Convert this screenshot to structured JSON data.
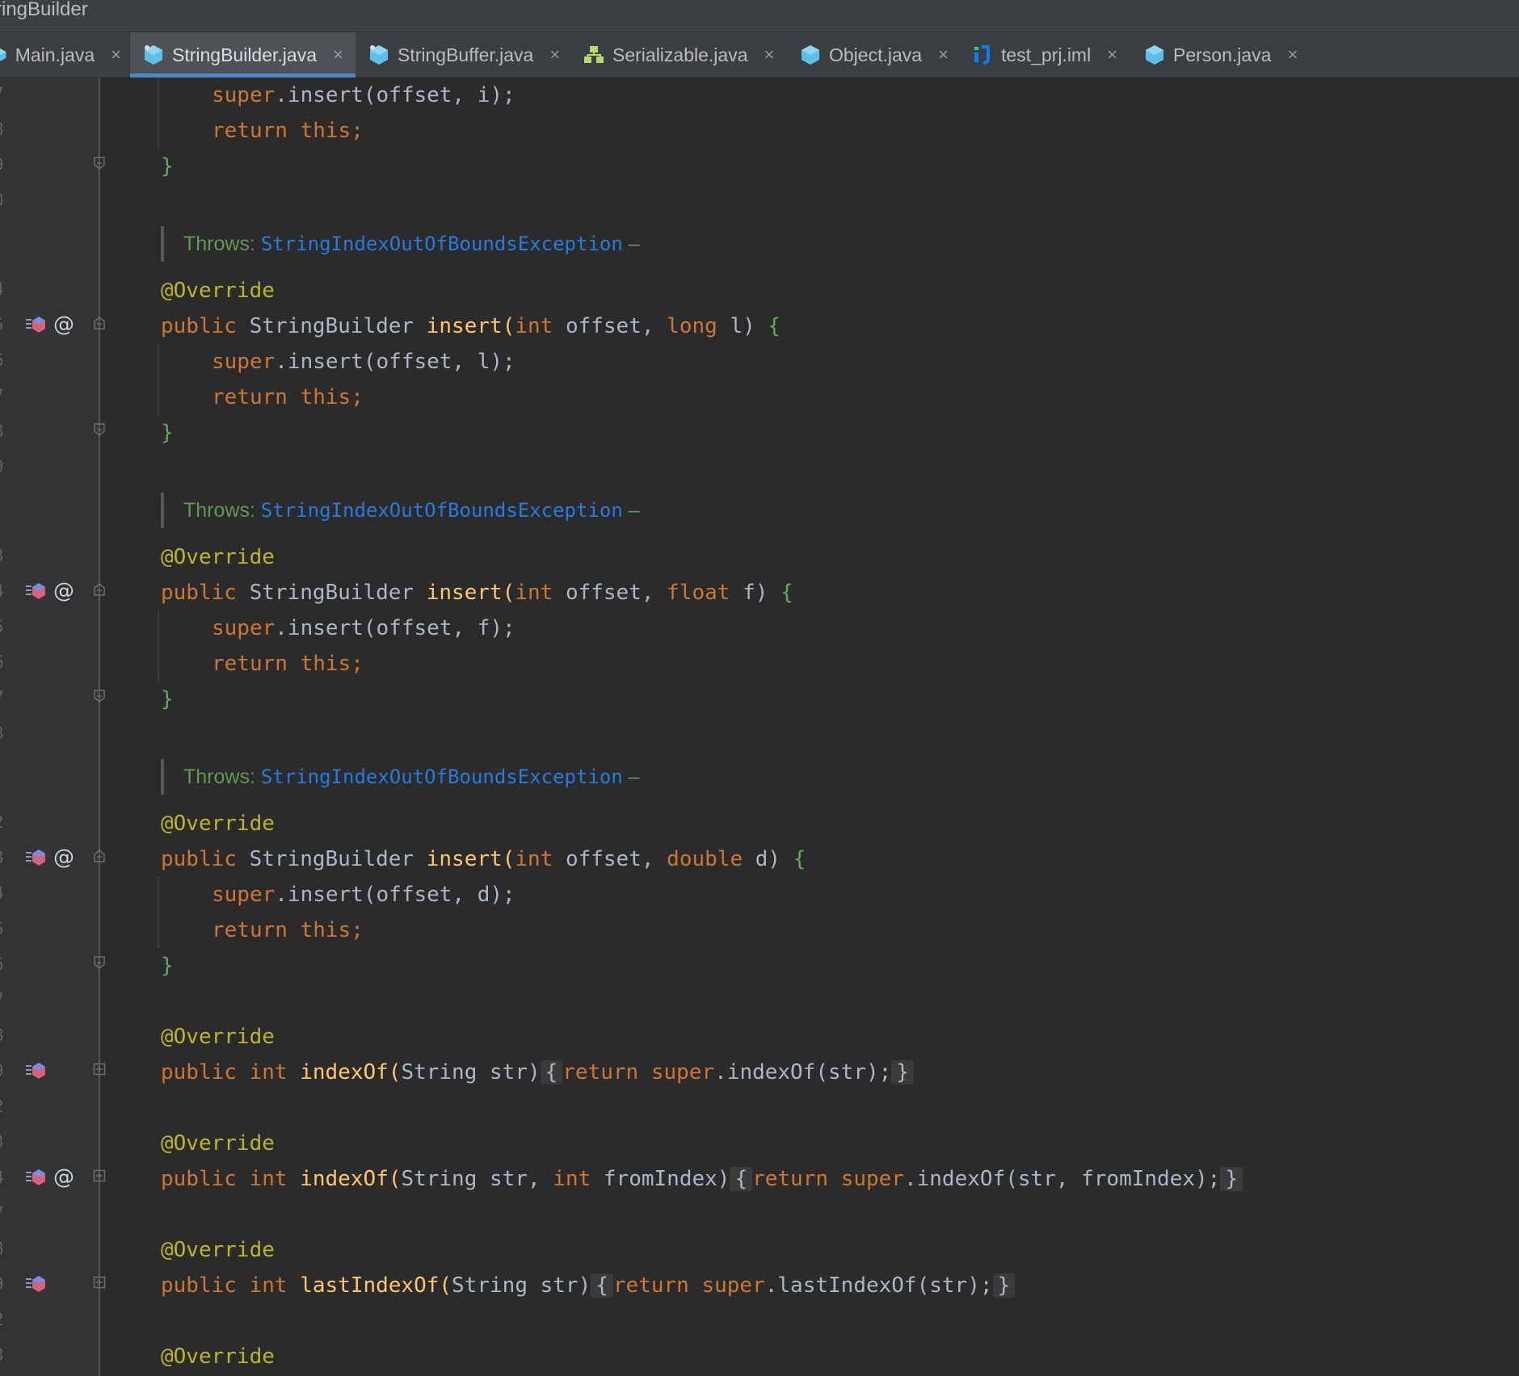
{
  "window": {
    "title": "ringBuilder"
  },
  "tabs": [
    {
      "label": "Main.java",
      "icon": "java-class-icon",
      "active": false
    },
    {
      "label": "StringBuilder.java",
      "icon": "java-class-icon",
      "active": true
    },
    {
      "label": "StringBuffer.java",
      "icon": "java-class-icon",
      "active": false
    },
    {
      "label": "Serializable.java",
      "icon": "interface-icon",
      "active": false
    },
    {
      "label": "Object.java",
      "icon": "java-class-icon",
      "active": false
    },
    {
      "label": "test_prj.iml",
      "icon": "iml-file-icon",
      "active": false
    },
    {
      "label": "Person.java",
      "icon": "java-class-icon",
      "active": false
    }
  ],
  "tab_close": "×",
  "line_numbers": [
    "7",
    "8",
    "9",
    "0",
    "4",
    "5",
    "6",
    "7",
    "8",
    "9",
    "3",
    "4",
    "5",
    "6",
    "7",
    "8",
    "2",
    "3",
    "4",
    "5",
    "6",
    "7",
    "8",
    "9",
    "2",
    "3",
    "4",
    "7",
    "8",
    "9",
    "2",
    "3"
  ],
  "code": {
    "super": "super",
    "insert_call": ".insert(",
    "offset_i": "offset, i);",
    "return": "return",
    "this": "this;",
    "close_brace": "}",
    "throws_label": "Throws:",
    "exception": "StringIndexOutOfBoundsException",
    "dash": "–",
    "override": "@Override",
    "public": "public",
    "string_builder": "StringBuilder",
    "insert": "insert",
    "open_paren": "(",
    "int": "int",
    "offset_comma": "offset,",
    "long": "long",
    "l_param": "l)",
    "float": "float",
    "f_param": "f)",
    "double": "double",
    "d_param": "d)",
    "open_brace": "{",
    "offset_l": "offset, l);",
    "offset_f": "offset, f);",
    "offset_d": "offset, d);",
    "index_of": "indexOf",
    "last_index_of": "lastIndexOf",
    "string_str": "String str)",
    "string_str_comma": "String str,",
    "from_index_param": "fromIndex)",
    "super_index_of_str": ".indexOf(str);",
    "super_index_of_str_from": ".indexOf(str, fromIndex);",
    "super_last_index_of_str": ".lastIndexOf(str);"
  },
  "gutter_at": "@",
  "colors": {
    "background": "#2b2b2b",
    "keyword": "#cc7832",
    "annotation": "#bbb529",
    "method": "#ffc66d",
    "doc": "#629755",
    "link": "#287bde",
    "accent": "#4a88c7"
  }
}
